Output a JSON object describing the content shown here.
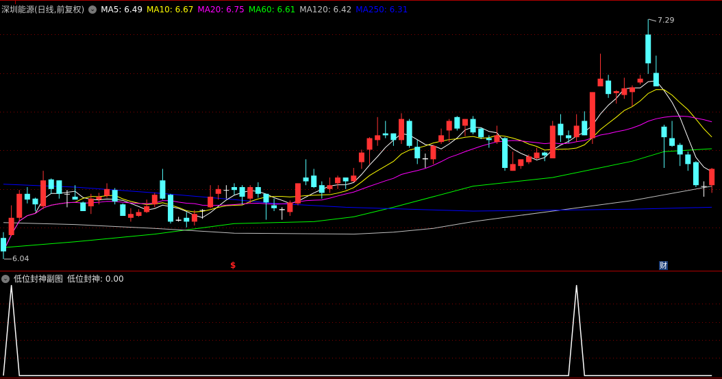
{
  "header": {
    "title": "深圳能源(日线,前复权)",
    "ma": [
      {
        "label": "MA5: 6.49",
        "color": "#ffffff"
      },
      {
        "label": "MA10: 6.67",
        "color": "#ffff00"
      },
      {
        "label": "MA20: 6.75",
        "color": "#ff00ff"
      },
      {
        "label": "MA60: 6.61",
        "color": "#00ff00"
      },
      {
        "label": "MA120: 6.42",
        "color": "#c0c0c0"
      },
      {
        "label": "MA250: 6.31",
        "color": "#0000ff"
      }
    ]
  },
  "annotations": {
    "high_label": "7.29",
    "low_label": "6.04",
    "marker_s": "$",
    "marker_cai": "财"
  },
  "sub_header": {
    "title": "低位封神副图",
    "value_label": "低位封神: 0.00"
  },
  "colors": {
    "up": "#ff3232",
    "down": "#54ffff",
    "doji": "#ffffff",
    "grid": "#8b0000",
    "frame": "#b00000"
  },
  "chart_data": [
    {
      "type": "candlestick",
      "title": "深圳能源(日线,前复权)",
      "ylim": [
        6.04,
        7.29
      ],
      "grid": true,
      "ohlc": [
        [
          6.15,
          6.08,
          6.18,
          6.04
        ],
        [
          6.165,
          6.255,
          6.32,
          6.16
        ],
        [
          6.255,
          6.38,
          6.4,
          6.24
        ],
        [
          6.38,
          6.35,
          6.415,
          6.33
        ],
        [
          6.355,
          6.325,
          6.36,
          6.29
        ],
        [
          6.315,
          6.45,
          6.5,
          6.3
        ],
        [
          6.455,
          6.405,
          6.46,
          6.38
        ],
        [
          6.45,
          6.38,
          6.45,
          6.355
        ],
        [
          6.38,
          6.38,
          6.4,
          6.31
        ],
        [
          6.365,
          6.35,
          6.425,
          6.35
        ],
        [
          6.335,
          6.29,
          6.34,
          6.29
        ],
        [
          6.315,
          6.355,
          6.38,
          6.275
        ],
        [
          6.35,
          6.365,
          6.385,
          6.325
        ],
        [
          6.37,
          6.405,
          6.435,
          6.36
        ],
        [
          6.4,
          6.34,
          6.41,
          6.325
        ],
        [
          6.325,
          6.265,
          6.33,
          6.265
        ],
        [
          6.255,
          6.275,
          6.305,
          6.235
        ],
        [
          6.265,
          6.285,
          6.3,
          6.26
        ],
        [
          6.285,
          6.315,
          6.35,
          6.28
        ],
        [
          6.325,
          6.375,
          6.385,
          6.31
        ],
        [
          6.45,
          6.355,
          6.51,
          6.35
        ],
        [
          6.375,
          6.235,
          6.38,
          6.225
        ],
        [
          6.245,
          6.24,
          6.26,
          6.235
        ],
        [
          6.255,
          6.235,
          6.285,
          6.205
        ],
        [
          6.235,
          6.275,
          6.295,
          6.215
        ],
        [
          6.295,
          6.295,
          6.3,
          6.25
        ],
        [
          6.31,
          6.365,
          6.425,
          6.305
        ],
        [
          6.38,
          6.405,
          6.425,
          6.35
        ],
        [
          6.4,
          6.4,
          6.425,
          6.355
        ],
        [
          6.415,
          6.4,
          6.435,
          6.375
        ],
        [
          6.415,
          6.365,
          6.425,
          6.325
        ],
        [
          6.355,
          6.415,
          6.425,
          6.33
        ],
        [
          6.415,
          6.38,
          6.44,
          6.36
        ],
        [
          6.38,
          6.335,
          6.38,
          6.245
        ],
        [
          6.32,
          6.305,
          6.355,
          6.29
        ],
        [
          6.3,
          6.295,
          6.31,
          6.245
        ],
        [
          6.285,
          6.335,
          6.345,
          6.265
        ],
        [
          6.33,
          6.435,
          6.435,
          6.32
        ],
        [
          6.465,
          6.445,
          6.56,
          6.425
        ],
        [
          6.475,
          6.415,
          6.51,
          6.41
        ],
        [
          6.425,
          6.385,
          6.445,
          6.355
        ],
        [
          6.405,
          6.425,
          6.465,
          6.385
        ],
        [
          6.435,
          6.465,
          6.475,
          6.405
        ],
        [
          6.465,
          6.445,
          6.465,
          6.405
        ],
        [
          6.445,
          6.475,
          6.515,
          6.44
        ],
        [
          6.545,
          6.595,
          6.61,
          6.51
        ],
        [
          6.61,
          6.67,
          6.675,
          6.535
        ],
        [
          6.66,
          6.685,
          6.78,
          6.63
        ],
        [
          6.695,
          6.685,
          6.76,
          6.67
        ],
        [
          6.695,
          6.66,
          6.695,
          6.63
        ],
        [
          6.66,
          6.77,
          6.8,
          6.64
        ],
        [
          6.76,
          6.63,
          6.77,
          6.62
        ],
        [
          6.625,
          6.565,
          6.66,
          6.535
        ],
        [
          6.565,
          6.56,
          6.59,
          6.515
        ],
        [
          6.56,
          6.63,
          6.635,
          6.535
        ],
        [
          6.65,
          6.685,
          6.72,
          6.64
        ],
        [
          6.71,
          6.76,
          6.77,
          6.65
        ],
        [
          6.78,
          6.72,
          6.785,
          6.71
        ],
        [
          6.735,
          6.77,
          6.77,
          6.68
        ],
        [
          6.77,
          6.7,
          6.785,
          6.69
        ],
        [
          6.72,
          6.675,
          6.725,
          6.665
        ],
        [
          6.67,
          6.66,
          6.685,
          6.62
        ],
        [
          6.65,
          6.685,
          6.735,
          6.64
        ],
        [
          6.67,
          6.515,
          6.675,
          6.5
        ],
        [
          6.5,
          6.535,
          6.6,
          6.5
        ],
        [
          6.525,
          6.56,
          6.56,
          6.51
        ],
        [
          6.545,
          6.575,
          6.585,
          6.535
        ],
        [
          6.565,
          6.595,
          6.62,
          6.56
        ],
        [
          6.595,
          6.58,
          6.6,
          6.55
        ],
        [
          6.565,
          6.735,
          6.76,
          6.565
        ],
        [
          6.745,
          6.685,
          6.795,
          6.65
        ],
        [
          6.685,
          6.67,
          6.71,
          6.645
        ],
        [
          6.675,
          6.735,
          6.795,
          6.65
        ],
        [
          6.76,
          6.685,
          6.81,
          6.685
        ],
        [
          6.67,
          6.91,
          6.91,
          6.64
        ],
        [
          6.94,
          6.98,
          7.11,
          6.94
        ],
        [
          6.97,
          6.9,
          7.0,
          6.88
        ],
        [
          6.905,
          6.915,
          6.92,
          6.85
        ],
        [
          6.895,
          6.93,
          6.985,
          6.875
        ],
        [
          6.91,
          6.935,
          6.945,
          6.835
        ],
        [
          6.96,
          6.98,
          7.0,
          6.95
        ],
        [
          7.21,
          7.06,
          7.29,
          7.005
        ],
        [
          7.01,
          6.94,
          7.1,
          6.94
        ],
        [
          6.73,
          6.675,
          6.74,
          6.515
        ],
        [
          6.67,
          6.63,
          6.76,
          6.625
        ],
        [
          6.635,
          6.585,
          6.645,
          6.525
        ],
        [
          6.585,
          6.535,
          6.6,
          6.5
        ],
        [
          6.545,
          6.425,
          6.55,
          6.415
        ],
        [
          6.42,
          6.42,
          6.445,
          6.365
        ],
        [
          6.425,
          6.51,
          6.515,
          6.385
        ]
      ],
      "computed_ma": [
        {
          "name": "MA5",
          "period": 5,
          "color": "#ffffff"
        },
        {
          "name": "MA10",
          "period": 10,
          "color": "#ffff00"
        },
        {
          "name": "MA20",
          "period": 20,
          "color": "#ff00ff"
        }
      ],
      "sampled_ma": [
        {
          "name": "MA60",
          "color": "#00ff00",
          "points": [
            [
              1,
              6.1
            ],
            [
              10,
              6.13
            ],
            [
              20,
              6.17
            ],
            [
              30,
              6.225
            ],
            [
              40,
              6.235
            ],
            [
              45,
              6.26
            ],
            [
              50,
              6.31
            ],
            [
              60,
              6.42
            ],
            [
              70,
              6.465
            ],
            [
              80,
              6.55
            ],
            [
              84,
              6.6
            ],
            [
              90,
              6.615
            ]
          ]
        },
        {
          "name": "MA120",
          "color": "#c0c0c0",
          "points": [
            [
              1,
              6.23
            ],
            [
              10,
              6.22
            ],
            [
              20,
              6.2
            ],
            [
              30,
              6.175
            ],
            [
              45,
              6.17
            ],
            [
              50,
              6.18
            ],
            [
              55,
              6.2
            ],
            [
              60,
              6.235
            ],
            [
              70,
              6.29
            ],
            [
              80,
              6.345
            ],
            [
              90,
              6.42
            ]
          ]
        },
        {
          "name": "MA250",
          "color": "#0000ff",
          "points": [
            [
              1,
              6.43
            ],
            [
              10,
              6.415
            ],
            [
              20,
              6.385
            ],
            [
              30,
              6.35
            ],
            [
              35,
              6.33
            ],
            [
              44,
              6.31
            ],
            [
              52,
              6.3
            ],
            [
              60,
              6.29
            ],
            [
              70,
              6.295
            ],
            [
              80,
              6.3
            ],
            [
              90,
              6.31
            ]
          ]
        }
      ]
    },
    {
      "type": "line",
      "title": "低位封神副图",
      "series": [
        {
          "name": "低位封神",
          "color": "#ffffff",
          "spikes_at_candle": [
            2,
            73
          ],
          "spike_value": 1,
          "base_value": 0
        }
      ],
      "ylim": [
        0,
        1
      ]
    }
  ]
}
